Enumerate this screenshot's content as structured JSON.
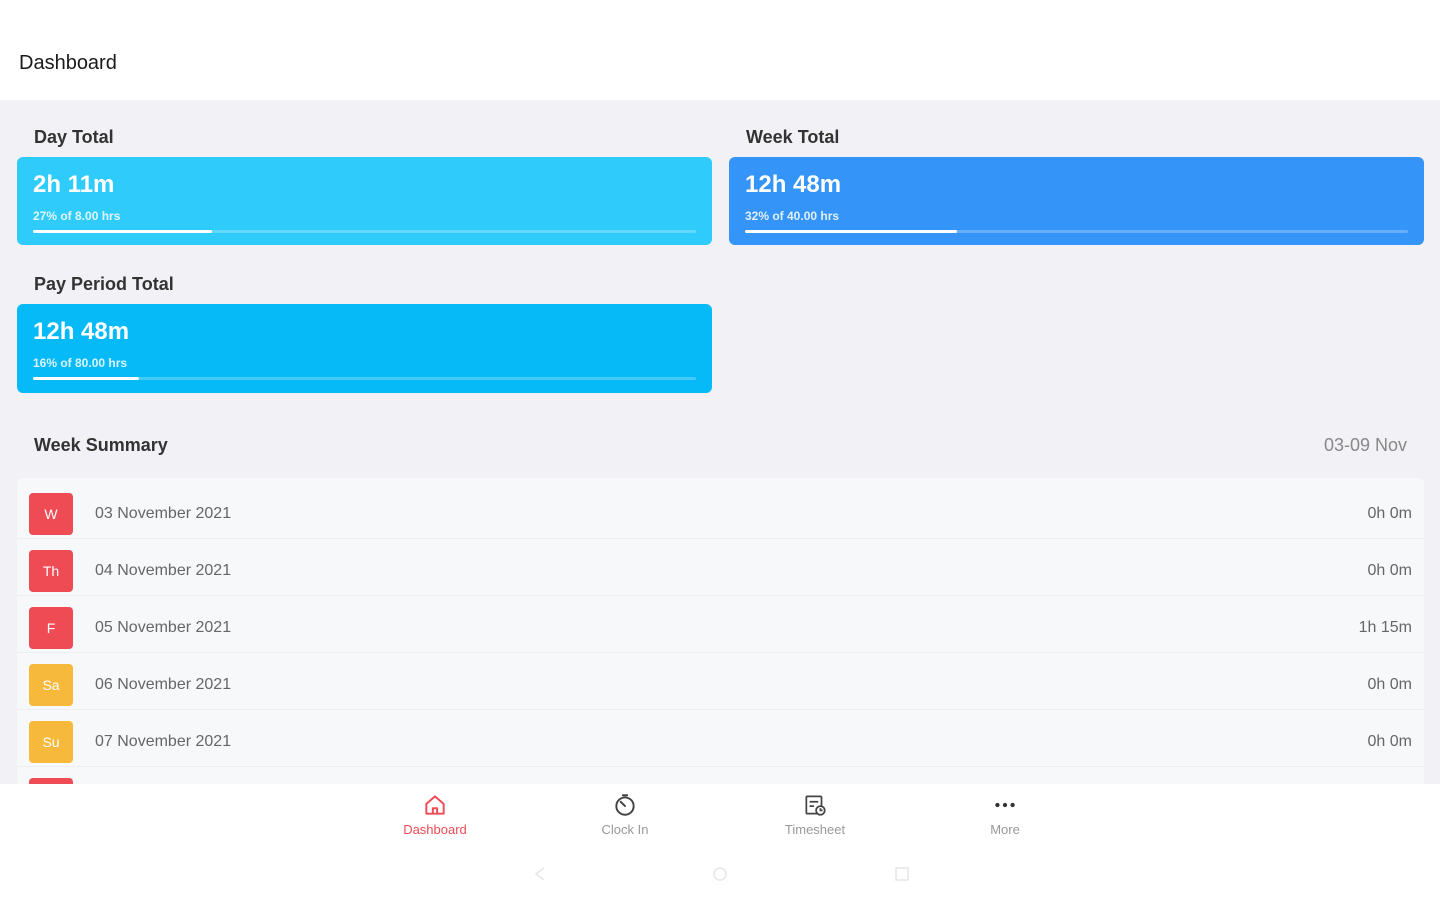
{
  "header": {
    "title": "Dashboard"
  },
  "day_total": {
    "label": "Day Total",
    "value": "2h 11m",
    "subtitle": "27% of 8.00 hrs",
    "progress_percent": 27,
    "color": "#2ecbfb"
  },
  "week_total": {
    "label": "Week Total",
    "value": "12h 48m",
    "subtitle": "32% of 40.00 hrs",
    "progress_percent": 32,
    "color": "#3594f8"
  },
  "pay_period_total": {
    "label": "Pay Period Total",
    "value": "12h 48m",
    "subtitle": "16% of 80.00 hrs",
    "progress_percent": 16,
    "color": "#06baf8"
  },
  "week_summary": {
    "label": "Week Summary",
    "range": "03-09 Nov",
    "days": [
      {
        "abbr": "W",
        "date": "03 November 2021",
        "hours": "0h 0m",
        "color": "#ee4b55"
      },
      {
        "abbr": "Th",
        "date": "04 November 2021",
        "hours": "0h 0m",
        "color": "#ee4b55"
      },
      {
        "abbr": "F",
        "date": "05 November 2021",
        "hours": "1h 15m",
        "color": "#ee4b55"
      },
      {
        "abbr": "Sa",
        "date": "06 November 2021",
        "hours": "0h 0m",
        "color": "#f6b93b"
      },
      {
        "abbr": "Su",
        "date": "07 November 2021",
        "hours": "0h 0m",
        "color": "#f6b93b"
      }
    ]
  },
  "bottom_nav": {
    "items": [
      {
        "label": "Dashboard",
        "icon": "home-icon",
        "active": true
      },
      {
        "label": "Clock In",
        "icon": "timer-icon",
        "active": false
      },
      {
        "label": "Timesheet",
        "icon": "timesheet-icon",
        "active": false
      },
      {
        "label": "More",
        "icon": "more-icon",
        "active": false
      }
    ]
  },
  "colors": {
    "accent": "#ee4b55",
    "weekend": "#f6b93b"
  }
}
